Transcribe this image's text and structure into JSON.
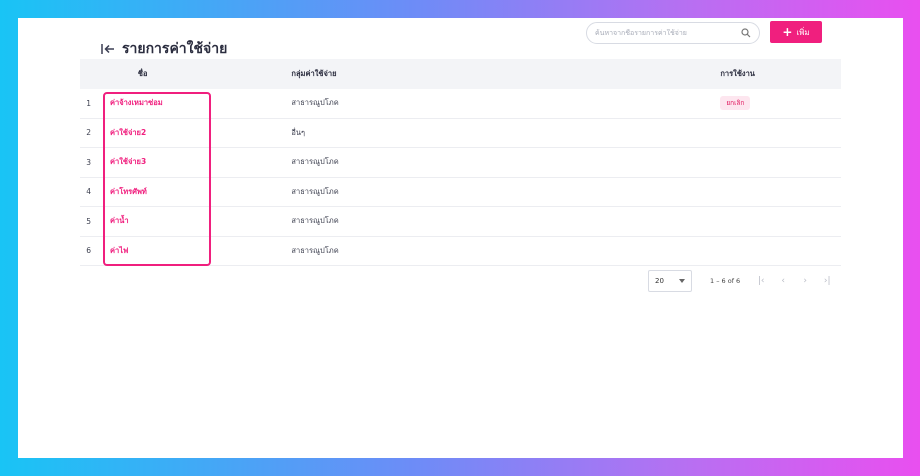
{
  "header": {
    "title": "รายการค่าใช้จ่าย"
  },
  "search": {
    "placeholder": "ค้นหาจากชื่อรายการค่าใช้จ่าย"
  },
  "add_button": {
    "label": "เพิ่ม"
  },
  "table": {
    "columns": [
      "ชื่อ",
      "กลุ่มค่าใช้จ่าย",
      "การใช้งาน"
    ],
    "rows": [
      {
        "index": "1",
        "name": "ค่าจ้างเหมาซ่อม",
        "group": "สาธารณูปโภค",
        "status": "ยกเลิก"
      },
      {
        "index": "2",
        "name": "ค่าใช้จ่าย2",
        "group": "อื่นๆ",
        "status": ""
      },
      {
        "index": "3",
        "name": "ค่าใช้จ่าย3",
        "group": "สาธารณูปโภค",
        "status": ""
      },
      {
        "index": "4",
        "name": "ค่าโทรศัพท์",
        "group": "สาธารณูปโภค",
        "status": ""
      },
      {
        "index": "5",
        "name": "ค่าน้ำ",
        "group": "สาธารณูปโภค",
        "status": ""
      },
      {
        "index": "6",
        "name": "ค่าไฟ",
        "group": "สาธารณูปโภค",
        "status": ""
      }
    ]
  },
  "pagination": {
    "page_size": "20",
    "range": "1 – 6 of 6"
  },
  "colors": {
    "accent": "#f01f7e",
    "header_bg": "#f3f4f7"
  }
}
